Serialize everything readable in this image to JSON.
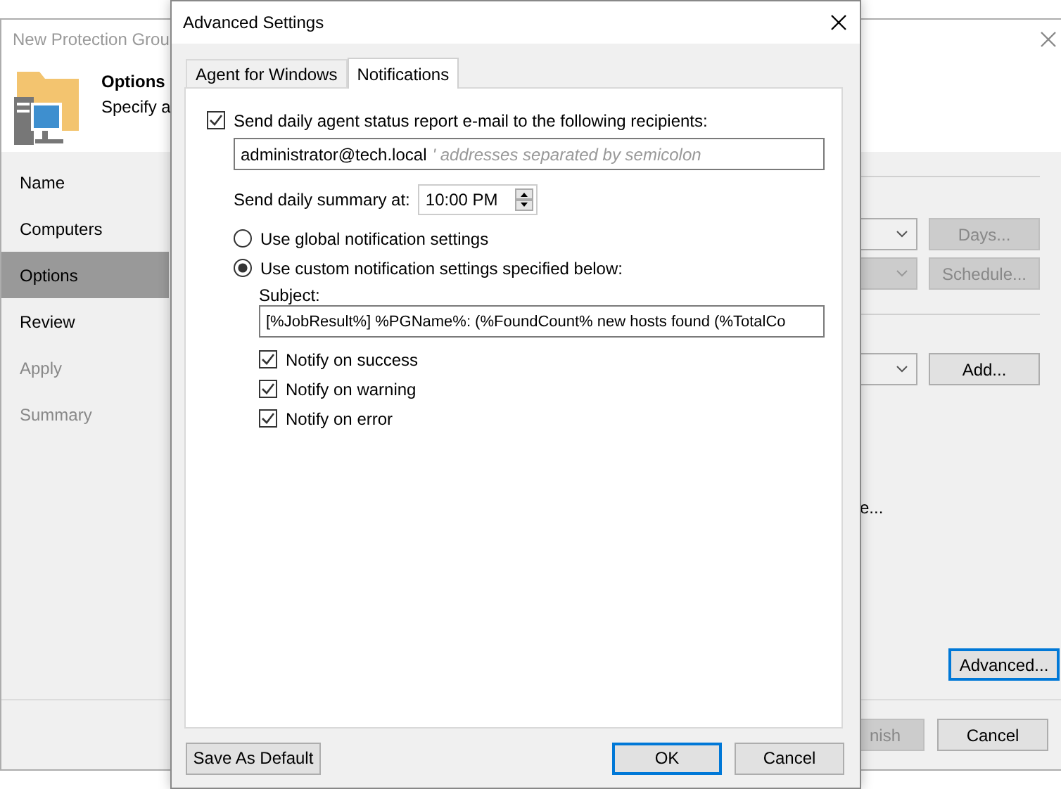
{
  "wizard": {
    "title": "New Protection Grou",
    "header": {
      "title": "Options",
      "subtitle": "Specify a"
    },
    "steps": [
      {
        "label": "Name",
        "selected": false,
        "disabled": false
      },
      {
        "label": "Computers",
        "selected": false,
        "disabled": false
      },
      {
        "label": "Options",
        "selected": true,
        "disabled": false
      },
      {
        "label": "Review",
        "selected": false,
        "disabled": false
      },
      {
        "label": "Apply",
        "selected": false,
        "disabled": true
      },
      {
        "label": "Summary",
        "selected": false,
        "disabled": true
      }
    ],
    "schedule_rows": [
      {
        "dropdown_disabled": false,
        "button": "Days...",
        "button_disabled": true
      },
      {
        "dropdown_disabled": true,
        "button": "Schedule...",
        "button_disabled": true
      }
    ],
    "target_row": {
      "dropdown_disabled": false,
      "button": "Add...",
      "button_disabled": false
    },
    "cut_text": "e...",
    "advanced_button": {
      "label": "Advanced...",
      "focused": true
    },
    "footer_buttons": [
      {
        "label": "nish",
        "disabled": true
      },
      {
        "label": "Cancel",
        "disabled": false
      }
    ]
  },
  "dialog": {
    "title": "Advanced Settings",
    "tabs": [
      {
        "label": "Agent for Windows",
        "selected": false
      },
      {
        "label": "Notifications",
        "selected": true
      }
    ],
    "report": {
      "label": "Send daily agent status report e-mail to the following recipients:",
      "checked": true
    },
    "recipients": {
      "value": "administrator@tech.local",
      "hint": "' addresses separated by semicolon"
    },
    "summary_time": {
      "label": "Send daily summary at:",
      "value": "10:00 PM"
    },
    "notification_options": [
      {
        "label": "Use global notification settings",
        "selected": false
      },
      {
        "label": "Use custom notification settings specified below:",
        "selected": true
      }
    ],
    "subject": {
      "label": "Subject:",
      "value": "[%JobResult%] %PGName%: (%FoundCount% new hosts found (%TotalCo"
    },
    "notify": [
      {
        "label": "Notify on success",
        "checked": true
      },
      {
        "label": "Notify on warning",
        "checked": true
      },
      {
        "label": "Notify on error",
        "checked": true
      }
    ],
    "buttons": [
      {
        "label": "Save As Default",
        "default": false
      },
      {
        "label": "OK",
        "default": true
      },
      {
        "label": "Cancel",
        "default": false
      }
    ]
  }
}
